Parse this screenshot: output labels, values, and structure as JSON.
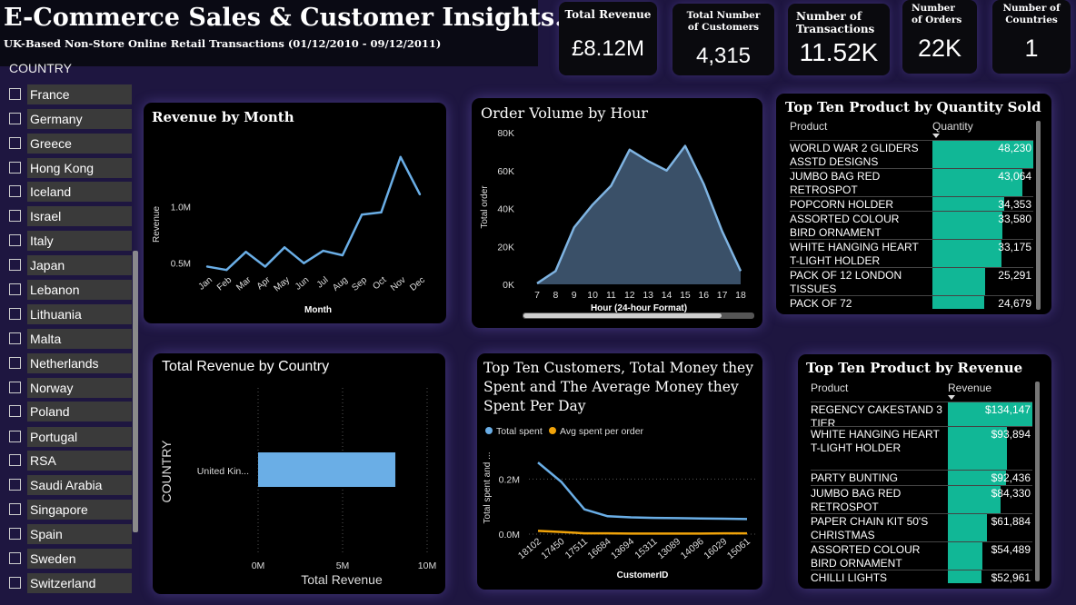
{
  "header": {
    "title": "E-Commerce Sales & Customer Insights.",
    "subtitle": "UK-Based Non-Store Online Retail Transactions (01/12/2010 - 09/12/2011)"
  },
  "kpis": [
    {
      "label": "Total Revenue",
      "value": "£8.12M"
    },
    {
      "label": "Total Number of Customers",
      "value": "4,315"
    },
    {
      "label": "Number of Transactions",
      "value": "11.52K"
    },
    {
      "label": "Number of Orders",
      "value": "22K"
    },
    {
      "label": "Number of Countries",
      "value": "1"
    }
  ],
  "slicer": {
    "header": "COUNTRY",
    "items": [
      "France",
      "Germany",
      "Greece",
      "Hong Kong",
      "Iceland",
      "Israel",
      "Italy",
      "Japan",
      "Lebanon",
      "Lithuania",
      "Malta",
      "Netherlands",
      "Norway",
      "Poland",
      "Portugal",
      "RSA",
      "Saudi Arabia",
      "Singapore",
      "Spain",
      "Sweden",
      "Switzerland"
    ]
  },
  "revenue_by_month": {
    "title": "Revenue by Month",
    "chart_data": {
      "type": "line",
      "categories": [
        "Jan",
        "Feb",
        "Mar",
        "Apr",
        "May",
        "Jun",
        "Jul",
        "Aug",
        "Sep",
        "Oct",
        "Nov",
        "Dec"
      ],
      "values": [
        0.47,
        0.44,
        0.6,
        0.47,
        0.64,
        0.5,
        0.61,
        0.57,
        0.93,
        0.95,
        1.44,
        1.11
      ],
      "xlabel": "Month",
      "ylabel": "Revenue",
      "yticks": [
        "0.5M",
        "1.0M"
      ],
      "ylim": [
        0.2,
        1.6
      ],
      "color": "#6aaee6"
    }
  },
  "order_volume_by_hour": {
    "title": "Order Volume by Hour",
    "chart_data": {
      "type": "area",
      "categories": [
        "7",
        "8",
        "9",
        "10",
        "11",
        "12",
        "13",
        "14",
        "15",
        "16",
        "17",
        "18"
      ],
      "values": [
        500,
        7000,
        30000,
        42000,
        52000,
        71000,
        65000,
        60000,
        73000,
        53000,
        28000,
        7000
      ],
      "xlabel": "Hour (24-hour Format)",
      "ylabel": "Total order",
      "yticks": [
        "0K",
        "20K",
        "40K",
        "60K",
        "80K"
      ],
      "ylim": [
        0,
        80000
      ],
      "color": "#3a5068",
      "line_color": "#7fb4e2"
    }
  },
  "top_products_qty": {
    "title": "Top Ten Product by Quantity Sold",
    "col_product": "Product",
    "col_value": "Quantity",
    "max": 48230,
    "rows": [
      {
        "product": "WORLD WAR 2 GLIDERS ASSTD DESIGNS",
        "value": "48,230",
        "num": 48230
      },
      {
        "product": "JUMBO BAG RED RETROSPOT",
        "value": "43,064",
        "num": 43064
      },
      {
        "product": "POPCORN HOLDER",
        "value": "34,353",
        "num": 34353
      },
      {
        "product": "ASSORTED COLOUR BIRD ORNAMENT",
        "value": "33,580",
        "num": 33580
      },
      {
        "product": "WHITE HANGING HEART T-LIGHT HOLDER",
        "value": "33,175",
        "num": 33175
      },
      {
        "product": "PACK OF 12 LONDON TISSUES",
        "value": "25,291",
        "num": 25291
      },
      {
        "product": "PACK OF 72",
        "value": "24,679",
        "num": 24679
      }
    ]
  },
  "revenue_by_country": {
    "title": "Total Revenue by Country",
    "chart_data": {
      "type": "bar",
      "orientation": "horizontal",
      "categories": [
        "United Kin..."
      ],
      "values": [
        8.12
      ],
      "xlabel": "Total Revenue",
      "ylabel": "COUNTRY",
      "xticks": [
        "0M",
        "5M",
        "10M"
      ],
      "xlim": [
        0,
        10
      ],
      "color": "#6aaee6"
    }
  },
  "top_customers": {
    "title_lines": [
      "Top Ten Customers, Total Money they",
      "Spent and The Average Money they",
      "Spent Per Day"
    ],
    "chart_data": {
      "type": "line",
      "categories": [
        "18102",
        "17450",
        "17511",
        "16684",
        "13694",
        "15311",
        "13089",
        "14096",
        "16029",
        "15061"
      ],
      "series": [
        {
          "name": "Total spent",
          "color": "#6aaee6",
          "values": [
            0.26,
            0.19,
            0.09,
            0.065,
            0.061,
            0.059,
            0.058,
            0.057,
            0.056,
            0.055
          ]
        },
        {
          "name": "Avg spent per order",
          "color": "#f0a30a",
          "values": [
            0.012,
            0.008,
            0.003,
            0.003,
            0.002,
            0.002,
            0.002,
            0.002,
            0.003,
            0.003
          ]
        }
      ],
      "xlabel": "CustomerID",
      "ylabel": "Total spent and ...",
      "yticks": [
        "0.0M",
        "0.2M"
      ],
      "ylim": [
        0,
        0.3
      ]
    }
  },
  "top_products_rev": {
    "title": "Top Ten Product by Revenue",
    "col_product": "Product",
    "col_value": "Revenue",
    "max": 134147,
    "rows": [
      {
        "product": "REGENCY CAKESTAND 3 TIER",
        "value": "$134,147",
        "num": 134147
      },
      {
        "product": "WHITE HANGING HEART T-LIGHT HOLDER",
        "value": "$93,894",
        "num": 93894
      },
      {
        "product": "PARTY BUNTING",
        "value": "$92,436",
        "num": 92436
      },
      {
        "product": "JUMBO BAG RED RETROSPOT",
        "value": "$84,330",
        "num": 84330
      },
      {
        "product": "PAPER CHAIN KIT 50'S CHRISTMAS",
        "value": "$61,884",
        "num": 61884
      },
      {
        "product": "ASSORTED COLOUR BIRD ORNAMENT",
        "value": "$54,489",
        "num": 54489
      },
      {
        "product": "CHILLI LIGHTS",
        "value": "$52,961",
        "num": 52961
      }
    ]
  }
}
